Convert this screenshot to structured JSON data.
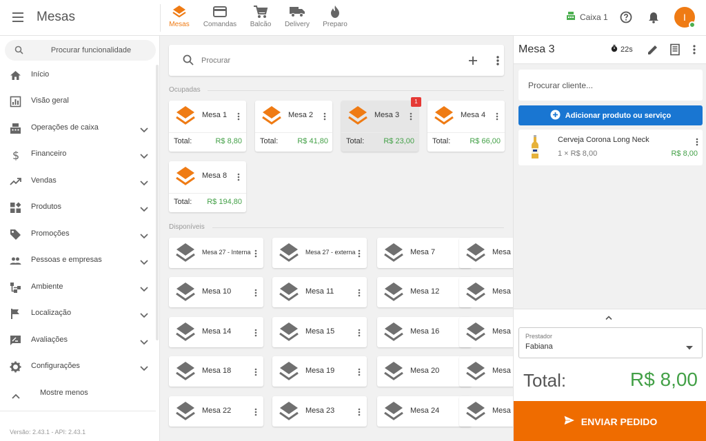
{
  "header": {
    "title": "Mesas",
    "tabs": [
      {
        "label": "Mesas",
        "icon": "layers-icon",
        "active": true
      },
      {
        "label": "Comandas",
        "icon": "card-icon"
      },
      {
        "label": "Balcão",
        "icon": "cart-icon"
      },
      {
        "label": "Delivery",
        "icon": "truck-icon"
      },
      {
        "label": "Preparo",
        "icon": "fire-icon"
      }
    ],
    "caixa": "Caixa 1",
    "avatar_initial": "I",
    "accent_color": "#ef7b14"
  },
  "sidebar": {
    "search_placeholder": "Procurar funcionalidade",
    "items": [
      {
        "label": "Início",
        "icon": "home-icon",
        "expandable": false
      },
      {
        "label": "Visão geral",
        "icon": "chart-icon",
        "expandable": false
      },
      {
        "label": "Operações de caixa",
        "icon": "cash-register-icon",
        "expandable": true
      },
      {
        "label": "Financeiro",
        "icon": "dollar-icon",
        "expandable": true
      },
      {
        "label": "Vendas",
        "icon": "trending-up-icon",
        "expandable": true
      },
      {
        "label": "Produtos",
        "icon": "widgets-icon",
        "expandable": true
      },
      {
        "label": "Promoções",
        "icon": "tag-icon",
        "expandable": true
      },
      {
        "label": "Pessoas e empresas",
        "icon": "people-icon",
        "expandable": true
      },
      {
        "label": "Ambiente",
        "icon": "sitemap-icon",
        "expandable": true
      },
      {
        "label": "Localização",
        "icon": "flag-icon",
        "expandable": true
      },
      {
        "label": "Avaliações",
        "icon": "rate-review-icon",
        "expandable": true
      },
      {
        "label": "Configurações",
        "icon": "settings-icon",
        "expandable": true
      }
    ],
    "show_less": "Mostre menos",
    "version": "Versão: 2.43.1 - API: 2.43.1"
  },
  "center": {
    "search_placeholder": "Procurar",
    "occupied_label": "Ocupadas",
    "available_label": "Disponíveis",
    "total_label": "Total:",
    "occupied": [
      {
        "name": "Mesa 1",
        "total": "R$ 8,80"
      },
      {
        "name": "Mesa 2",
        "total": "R$ 41,80"
      },
      {
        "name": "Mesa 3",
        "total": "R$ 23,00",
        "badge": "1",
        "selected": true
      },
      {
        "name": "Mesa 4",
        "total": "R$ 66,00"
      },
      {
        "name": "Mesa 8",
        "total": "R$ 194,80"
      }
    ],
    "available": [
      "Mesa 27 - Interna",
      "Mesa 27 - externa",
      "Mesa 7",
      "Mesa",
      "Mesa 10",
      "Mesa 11",
      "Mesa 12",
      "Mesa",
      "Mesa 14",
      "Mesa 15",
      "Mesa 16",
      "Mesa",
      "Mesa 18",
      "Mesa 19",
      "Mesa 20",
      "Mesa",
      "Mesa 22",
      "Mesa 23",
      "Mesa 24",
      "Mesa"
    ]
  },
  "order": {
    "title": "Mesa 3",
    "timer": "22s",
    "client_placeholder": "Procurar cliente...",
    "add_label": "Adicionar produto ou serviço",
    "items": [
      {
        "name": "Cerveja Corona Long Neck",
        "qty": "1 × R$ 8,00",
        "price": "R$ 8,00"
      }
    ],
    "prestador_label": "Prestador",
    "prestador_value": "Fabiana",
    "total_label": "Total:",
    "total_value": "R$ 8,00",
    "send_label": "ENVIAR PEDIDO"
  }
}
